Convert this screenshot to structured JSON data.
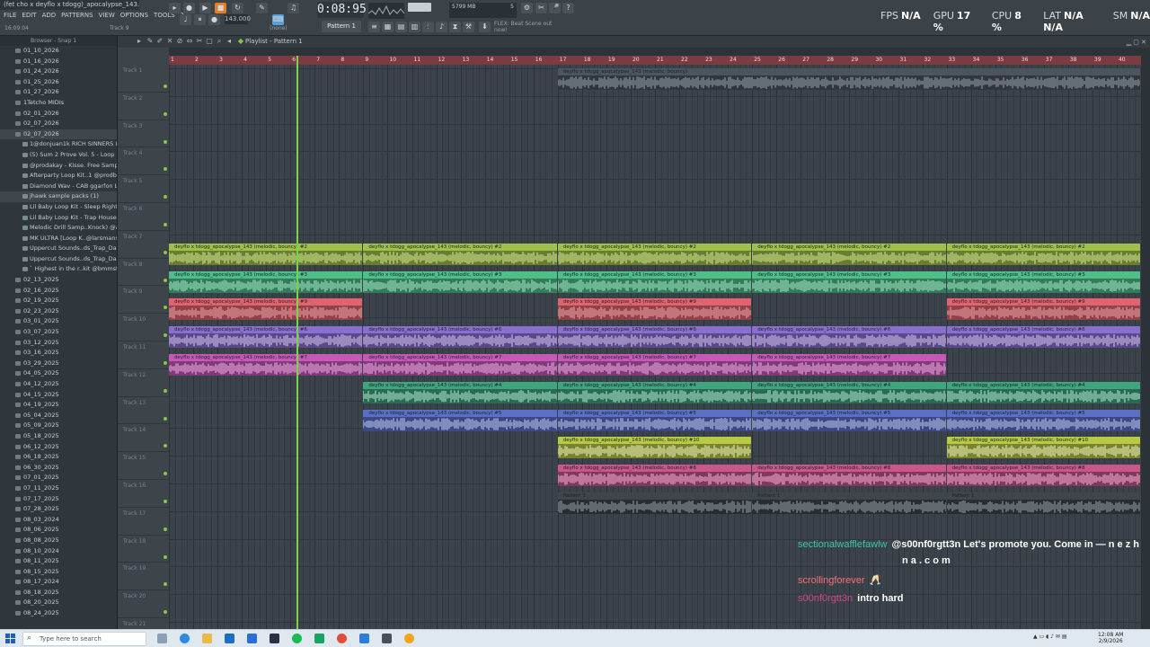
{
  "window": {
    "title": "(fet cho x deyflo x tdogg)_apocalypse_143...",
    "menu": [
      "FILE",
      "EDIT",
      "ADD",
      "PATTERNS",
      "VIEW",
      "OPTIONS",
      "TOOLS",
      "?"
    ],
    "clock_left": "16:09:04",
    "track_label": "Track 9"
  },
  "transport": {
    "song_position": "0:08:95",
    "tempo": "143.000",
    "pattern": "Pattern 1",
    "pattern_mode": "(none)",
    "memory": "5799 MB",
    "cpu_small": "5",
    "hint": "FLEX: Beat Scene out now!"
  },
  "perf": [
    {
      "label": "FPS",
      "value": "N/A"
    },
    {
      "label": "GPU",
      "value": "17 %"
    },
    {
      "label": "CPU",
      "value": "8 %"
    },
    {
      "label": "LAT",
      "value": "N/A  N/A"
    },
    {
      "label": "SM",
      "value": "N/A"
    }
  ],
  "browser": {
    "header": "Browser - Snap 1",
    "items": [
      {
        "label": "01_10_2026",
        "type": "folder"
      },
      {
        "label": "01_16_2026",
        "type": "folder"
      },
      {
        "label": "01_24_2026",
        "type": "folder"
      },
      {
        "label": "01_25_2026",
        "type": "folder"
      },
      {
        "label": "01_27_2026",
        "type": "folder"
      },
      {
        "label": "1Tetcho MIDIs",
        "type": "folder"
      },
      {
        "label": "02_01_2026",
        "type": "folder"
      },
      {
        "label": "02_07_2026",
        "type": "folder"
      },
      {
        "label": "02_07_2026",
        "type": "folder",
        "selected": true
      },
      {
        "label": "1@donjuan1k RICH SINNERS LOOP KIT",
        "type": "sub"
      },
      {
        "label": "(5) Sum 2 Prove Vol. 5 - Loop Kit",
        "type": "sub"
      },
      {
        "label": "@prodakay - Kisse. Free Sample Pack",
        "type": "sub"
      },
      {
        "label": "Afterparty Loop Kit..1 @prodbypatrick",
        "type": "sub"
      },
      {
        "label": "Diamond Wav - CAB ggarfon Loop Kit",
        "type": "sub"
      },
      {
        "label": "jhawk sample packs (1)",
        "type": "sub",
        "selected": true
      },
      {
        "label": "Lil Baby Loop Kit - Sleep Right",
        "type": "sub"
      },
      {
        "label": "Lil Baby Loop Kit - Trap House",
        "type": "sub"
      },
      {
        "label": "Melodic Drill Samp..Knock) @ayhr33",
        "type": "sub"
      },
      {
        "label": "MK ULTRA [Loop K..@larsmanson.wav]",
        "type": "sub"
      },
      {
        "label": "Uppercut Sounds..ds_Trap_Dark_mp3",
        "type": "sub"
      },
      {
        "label": "Uppercut Sounds..ds_Trap_Dark_mp3",
        "type": "sub"
      },
      {
        "label": "` Highest in the r..kit @bmmstagain",
        "type": "sub"
      },
      {
        "label": "02_13_2025",
        "type": "folder"
      },
      {
        "label": "02_16_2025",
        "type": "folder"
      },
      {
        "label": "02_19_2025",
        "type": "folder"
      },
      {
        "label": "02_23_2025",
        "type": "folder"
      },
      {
        "label": "03_01_2025",
        "type": "folder"
      },
      {
        "label": "03_07_2025",
        "type": "folder"
      },
      {
        "label": "03_12_2025",
        "type": "folder"
      },
      {
        "label": "03_16_2025",
        "type": "folder"
      },
      {
        "label": "03_29_2025",
        "type": "folder"
      },
      {
        "label": "04_05_2025",
        "type": "folder"
      },
      {
        "label": "04_12_2025",
        "type": "folder"
      },
      {
        "label": "04_15_2025",
        "type": "folder"
      },
      {
        "label": "04_19_2025",
        "type": "folder"
      },
      {
        "label": "05_04_2025",
        "type": "folder"
      },
      {
        "label": "05_09_2025",
        "type": "folder"
      },
      {
        "label": "05_18_2025",
        "type": "folder"
      },
      {
        "label": "06_12_2025",
        "type": "folder"
      },
      {
        "label": "06_18_2025",
        "type": "folder"
      },
      {
        "label": "06_30_2025",
        "type": "folder"
      },
      {
        "label": "07_01_2025",
        "type": "folder"
      },
      {
        "label": "07_11_2025",
        "type": "folder"
      },
      {
        "label": "07_17_2025",
        "type": "folder"
      },
      {
        "label": "07_28_2025",
        "type": "folder"
      },
      {
        "label": "08_03_2024",
        "type": "folder"
      },
      {
        "label": "08_06_2025",
        "type": "folder"
      },
      {
        "label": "08_08_2025",
        "type": "folder"
      },
      {
        "label": "08_10_2024",
        "type": "folder"
      },
      {
        "label": "08_11_2025",
        "type": "folder"
      },
      {
        "label": "08_15_2025",
        "type": "folder"
      },
      {
        "label": "08_17_2024",
        "type": "folder"
      },
      {
        "label": "08_18_2025",
        "type": "folder"
      },
      {
        "label": "08_20_2025",
        "type": "folder"
      },
      {
        "label": "08_24_2025",
        "type": "folder"
      }
    ]
  },
  "playlist": {
    "title": "Playlist - Pattern 1",
    "ruler": [
      "1",
      "2",
      "3",
      "4",
      "5",
      "6",
      "7",
      "8",
      "9",
      "10",
      "11",
      "12",
      "13",
      "14",
      "15",
      "16",
      "17",
      "18",
      "19",
      "20",
      "21",
      "22",
      "23",
      "24",
      "25",
      "26",
      "27",
      "28",
      "29",
      "30",
      "31",
      "32",
      "33",
      "34",
      "35",
      "36",
      "37",
      "38",
      "39",
      "40"
    ],
    "tracks": [
      "Track 1",
      "Track 2",
      "Track 3",
      "Track 4",
      "Track 5",
      "Track 6",
      "Track 7",
      "Track 8",
      "Track 9",
      "Track 10",
      "Track 11",
      "Track 12",
      "Track 13",
      "Track 14",
      "Track 15",
      "Track 16",
      "Track 17",
      "Track 18",
      "Track 19",
      "Track 20",
      "Track 21"
    ],
    "clips": [
      {
        "track": 0,
        "from": 17,
        "to": 41,
        "color": "#4a555d",
        "label": "deyflo x tdogg_apocalypse_143 (melodic, bouncy)",
        "wave": "#9aa6ad"
      },
      {
        "track": 6,
        "from": 1,
        "to": 9,
        "color": "#9fc04a",
        "label": "deyflo x tdogg_apocalypse_143 (melodic, bouncy) #2",
        "wave": "#d8ef9a"
      },
      {
        "track": 6,
        "from": 9,
        "to": 17,
        "color": "#9fc04a",
        "label": "deyflo x tdogg_apocalypse_143 (melodic, bouncy) #2",
        "wave": "#d8ef9a"
      },
      {
        "track": 6,
        "from": 17,
        "to": 25,
        "color": "#9fc04a",
        "label": "deyflo x tdogg_apocalypse_143 (melodic, bouncy) #2",
        "wave": "#d8ef9a"
      },
      {
        "track": 6,
        "from": 25,
        "to": 33,
        "color": "#9fc04a",
        "label": "deyflo x tdogg_apocalypse_143 (melodic, bouncy) #2",
        "wave": "#d8ef9a"
      },
      {
        "track": 6,
        "from": 33,
        "to": 41,
        "color": "#9fc04a",
        "label": "deyflo x tdogg_apocalypse_143 (melodic, bouncy) #2",
        "wave": "#d8ef9a"
      },
      {
        "track": 7,
        "from": 1,
        "to": 9,
        "color": "#4fbf8a",
        "label": "deyflo x tdogg_apocalypse_143 (melodic, bouncy) #3",
        "wave": "#a9f0cc"
      },
      {
        "track": 7,
        "from": 9,
        "to": 17,
        "color": "#4fbf8a",
        "label": "deyflo x tdogg_apocalypse_143 (melodic, bouncy) #3",
        "wave": "#a9f0cc"
      },
      {
        "track": 7,
        "from": 17,
        "to": 25,
        "color": "#4fbf8a",
        "label": "deyflo x tdogg_apocalypse_143 (melodic, bouncy) #3",
        "wave": "#a9f0cc"
      },
      {
        "track": 7,
        "from": 25,
        "to": 33,
        "color": "#4fbf8a",
        "label": "deyflo x tdogg_apocalypse_143 (melodic, bouncy) #3",
        "wave": "#a9f0cc"
      },
      {
        "track": 7,
        "from": 33,
        "to": 41,
        "color": "#4fbf8a",
        "label": "deyflo x tdogg_apocalypse_143 (melodic, bouncy) #3",
        "wave": "#a9f0cc"
      },
      {
        "track": 8,
        "from": 1,
        "to": 9,
        "color": "#e0646f",
        "label": "deyflo x tdogg_apocalypse_143 (melodic, bouncy) #9",
        "wave": "#f5a9b0"
      },
      {
        "track": 8,
        "from": 17,
        "to": 25,
        "color": "#e0646f",
        "label": "deyflo x tdogg_apocalypse_143 (melodic, bouncy) #9",
        "wave": "#f5a9b0"
      },
      {
        "track": 8,
        "from": 33,
        "to": 41,
        "color": "#e0646f",
        "label": "deyflo x tdogg_apocalypse_143 (melodic, bouncy) #9",
        "wave": "#f5a9b0"
      },
      {
        "track": 9,
        "from": 1,
        "to": 9,
        "color": "#8a6fd1",
        "label": "deyflo x tdogg_apocalypse_143 (melodic, bouncy) #6",
        "wave": "#d9cdf7"
      },
      {
        "track": 9,
        "from": 9,
        "to": 17,
        "color": "#8a6fd1",
        "label": "deyflo x tdogg_apocalypse_143 (melodic, bouncy) #6",
        "wave": "#d9cdf7"
      },
      {
        "track": 9,
        "from": 17,
        "to": 25,
        "color": "#8a6fd1",
        "label": "deyflo x tdogg_apocalypse_143 (melodic, bouncy) #6",
        "wave": "#d9cdf7"
      },
      {
        "track": 9,
        "from": 25,
        "to": 33,
        "color": "#8a6fd1",
        "label": "deyflo x tdogg_apocalypse_143 (melodic, bouncy) #6",
        "wave": "#d9cdf7"
      },
      {
        "track": 9,
        "from": 33,
        "to": 41,
        "color": "#8a6fd1",
        "label": "deyflo x tdogg_apocalypse_143 (melodic, bouncy) #6",
        "wave": "#d9cdf7"
      },
      {
        "track": 10,
        "from": 1,
        "to": 9,
        "color": "#c659b8",
        "label": "deyflo x tdogg_apocalypse_143 (melodic, bouncy) #7",
        "wave": "#f2b4ea"
      },
      {
        "track": 10,
        "from": 9,
        "to": 17,
        "color": "#c659b8",
        "label": "deyflo x tdogg_apocalypse_143 (melodic, bouncy) #7",
        "wave": "#f2b4ea"
      },
      {
        "track": 10,
        "from": 17,
        "to": 25,
        "color": "#c659b8",
        "label": "deyflo x tdogg_apocalypse_143 (melodic, bouncy) #7",
        "wave": "#f2b4ea"
      },
      {
        "track": 10,
        "from": 25,
        "to": 33,
        "color": "#c659b8",
        "label": "deyflo x tdogg_apocalypse_143 (melodic, bouncy) #7",
        "wave": "#f2b4ea"
      },
      {
        "track": 11,
        "from": 9,
        "to": 17,
        "color": "#3fa57e",
        "label": "deyflo x tdogg_apocalypse_143 (melodic, bouncy) #4",
        "wave": "#b7efd6"
      },
      {
        "track": 11,
        "from": 17,
        "to": 25,
        "color": "#3fa57e",
        "label": "deyflo x tdogg_apocalypse_143 (melodic, bouncy) #4",
        "wave": "#b7efd6"
      },
      {
        "track": 11,
        "from": 25,
        "to": 33,
        "color": "#3fa57e",
        "label": "deyflo x tdogg_apocalypse_143 (melodic, bouncy) #4",
        "wave": "#b7efd6"
      },
      {
        "track": 11,
        "from": 33,
        "to": 41,
        "color": "#3fa57e",
        "label": "deyflo x tdogg_apocalypse_143 (melodic, bouncy) #4",
        "wave": "#b7efd6"
      },
      {
        "track": 12,
        "from": 9,
        "to": 17,
        "color": "#5b6fc6",
        "label": "deyflo x tdogg_apocalypse_143 (melodic, bouncy) #5",
        "wave": "#c4cff5"
      },
      {
        "track": 12,
        "from": 17,
        "to": 25,
        "color": "#5b6fc6",
        "label": "deyflo x tdogg_apocalypse_143 (melodic, bouncy) #5",
        "wave": "#c4cff5"
      },
      {
        "track": 12,
        "from": 25,
        "to": 33,
        "color": "#5b6fc6",
        "label": "deyflo x tdogg_apocalypse_143 (melodic, bouncy) #5",
        "wave": "#c4cff5"
      },
      {
        "track": 12,
        "from": 33,
        "to": 41,
        "color": "#5b6fc6",
        "label": "deyflo x tdogg_apocalypse_143 (melodic, bouncy) #5",
        "wave": "#c4cff5"
      },
      {
        "track": 13,
        "from": 17,
        "to": 25,
        "color": "#b8c946",
        "label": "deyflo x tdogg_apocalypse_143 (melodic, bouncy) #10",
        "wave": "#f3f8c8"
      },
      {
        "track": 13,
        "from": 33,
        "to": 41,
        "color": "#b8c946",
        "label": "deyflo x tdogg_apocalypse_143 (melodic, bouncy) #10",
        "wave": "#f3f8c8"
      },
      {
        "track": 14,
        "from": 17,
        "to": 25,
        "color": "#c9578a",
        "label": "deyflo x tdogg_apocalypse_143 (melodic, bouncy) #8",
        "wave": "#f7b6d6"
      },
      {
        "track": 14,
        "from": 25,
        "to": 33,
        "color": "#c9578a",
        "label": "deyflo x tdogg_apocalypse_143 (melodic, bouncy) #8",
        "wave": "#f7b6d6"
      },
      {
        "track": 14,
        "from": 33,
        "to": 41,
        "color": "#c9578a",
        "label": "deyflo x tdogg_apocalypse_143 (melodic, bouncy) #8",
        "wave": "#f7b6d6"
      },
      {
        "track": 15,
        "from": 17,
        "to": 25,
        "color": "#3d464c",
        "label": "Pattern 1",
        "wave": "#9aa6ad"
      },
      {
        "track": 15,
        "from": 25,
        "to": 33,
        "color": "#3d464c",
        "label": "Pattern 1",
        "wave": "#9aa6ad"
      },
      {
        "track": 15,
        "from": 33,
        "to": 41,
        "color": "#3d464c",
        "label": "Pattern 1",
        "wave": "#9aa6ad"
      }
    ]
  },
  "chat": {
    "lines": [
      {
        "user": "sectionalwafflefawlw",
        "user_color": "#3ec6a8",
        "text": "@s00nf0rgtt3n Let's promote you. Come in — n e z h"
      },
      {
        "user": "",
        "user_color": "#ffffff",
        "text": "n a . c o m"
      },
      {
        "user": "scrollingforever",
        "user_color": "#ff6b7a",
        "text": "🥂"
      },
      {
        "user": "s00nf0rgtt3n",
        "user_color": "#d3458c",
        "text": "intro hard"
      }
    ]
  },
  "taskbar": {
    "search_placeholder": "Type here to search",
    "time": "12:08 AM",
    "date": "2/9/2026"
  }
}
